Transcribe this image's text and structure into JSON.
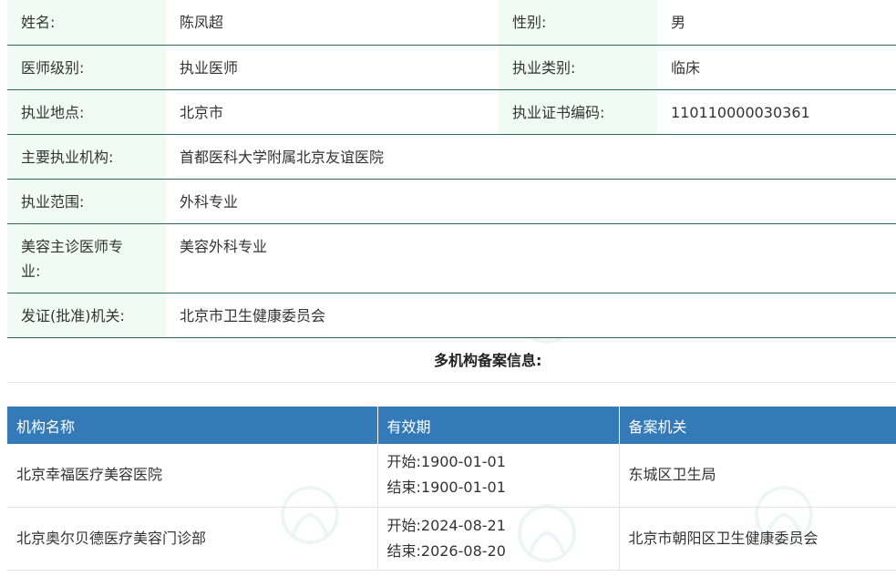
{
  "doctor_info": {
    "name_label": "姓名:",
    "name": "陈凤超",
    "gender_label": "性别:",
    "gender": "男",
    "level_label": "医师级别:",
    "level": "执业医师",
    "category_label": "执业类别:",
    "category": "临床",
    "location_label": "执业地点:",
    "location": "北京市",
    "cert_label": "执业证书编码:",
    "cert": "110110000030361",
    "institution_label": "主要执业机构:",
    "institution": "首都医科大学附属北京友谊医院",
    "scope_label": "执业范围:",
    "scope": "外科专业",
    "cosmetic_label_line1": "美容主诊医师专",
    "cosmetic_label_line2": "业:",
    "cosmetic": "美容外科专业",
    "authority_label": "发证(批准)机关:",
    "authority": "北京市卫生健康委员会"
  },
  "filing_section": {
    "title": "多机构备案信息:",
    "headers": {
      "institution": "机构名称",
      "period": "有效期",
      "authority": "备案机关"
    },
    "rows": [
      {
        "institution": "北京幸福医疗美容医院",
        "start": "开始:1900-01-01",
        "end": "结束:1900-01-01",
        "authority": "东城区卫生局"
      },
      {
        "institution": "北京奥尔贝德医疗美容门诊部",
        "start": "开始:2024-08-21",
        "end": "结束:2026-08-20",
        "authority": "北京市朝阳区卫生健康委员会"
      }
    ]
  },
  "colors": {
    "label_bg": "#f1fbf5",
    "row_border": "#2e6b4a",
    "header_bg": "#347ab8",
    "watermark": "#2a8c8c"
  }
}
